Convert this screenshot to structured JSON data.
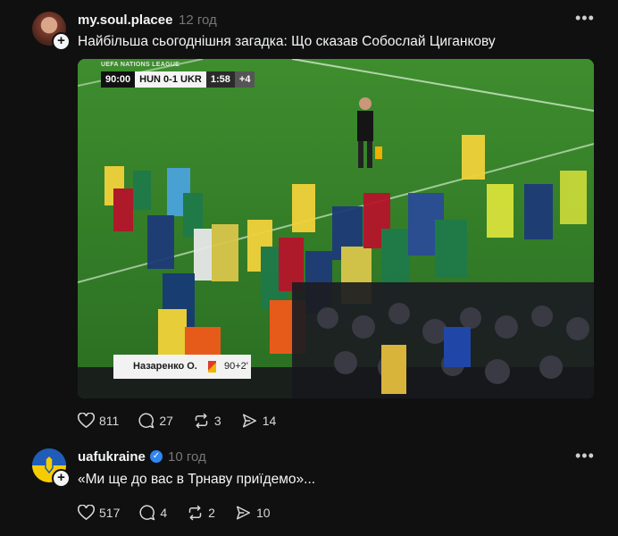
{
  "posts": [
    {
      "username": "my.soul.placee",
      "time": "12 год",
      "text": "Найбільша сьогоднішня загадка: Що сказав Собослай Циганкову",
      "media": {
        "scorebug": {
          "league": "UEFA NATIONS LEAGUE",
          "match_time": "90:00",
          "home": "HUN",
          "score": "0-1",
          "away": "UKR",
          "clock": "1:58",
          "added": "+4"
        },
        "lower_third": {
          "name": "Назаренко О.",
          "minute": "90+2'"
        }
      },
      "stats": {
        "likes": "811",
        "comments": "27",
        "reposts": "3",
        "shares": "14"
      }
    },
    {
      "username": "uafukraine",
      "time": "10 год",
      "text": "«Ми ще до вас в Трнаву приїдемо»...",
      "stats": {
        "likes": "517",
        "comments": "4",
        "reposts": "2",
        "shares": "10"
      }
    }
  ],
  "icons": {
    "like": "heart-icon",
    "comment": "comment-icon",
    "repost": "repost-icon",
    "share": "share-icon",
    "more": "more-icon",
    "verified": "verified-icon",
    "follow": "plus-icon"
  },
  "colors": {
    "background": "#101010",
    "text": "#f3f5f7",
    "muted": "#777777",
    "verified": "#2f86f0"
  }
}
